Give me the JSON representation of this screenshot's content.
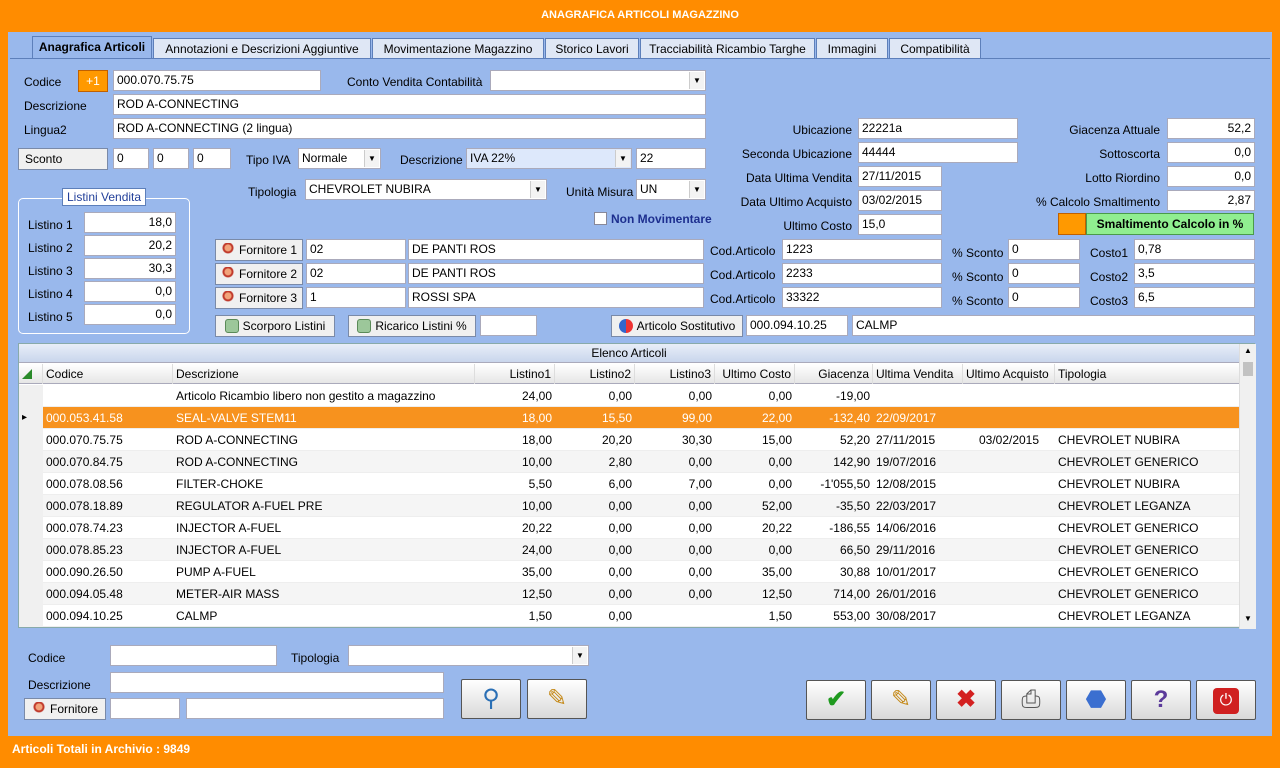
{
  "window": {
    "title": "ANAGRAFICA ARTICOLI MAGAZZINO"
  },
  "tabs": [
    {
      "label": "Anagrafica Articoli",
      "active": true
    },
    {
      "label": "Annotazioni  e Descrizioni Aggiuntive"
    },
    {
      "label": "Movimentazione Magazzino"
    },
    {
      "label": "Storico Lavori"
    },
    {
      "label": "Tracciabilità Ricambio Targhe"
    },
    {
      "label": "Immagini"
    },
    {
      "label": "Compatibilità"
    }
  ],
  "form": {
    "codice_label": "Codice",
    "plus_label": "+1",
    "codice_value": "000.070.75.75",
    "conto_label": "Conto Vendita Contabilità",
    "conto_value": "",
    "descrizione_label": "Descrizione",
    "descrizione_value": "ROD A-CONNECTING",
    "lingua2_label": "Lingua2",
    "lingua2_value": "ROD A-CONNECTING (2 lingua)",
    "sconto_label": "Sconto",
    "sconto1": "0",
    "sconto2": "0",
    "sconto3": "0",
    "tipo_iva_label": "Tipo IVA",
    "tipo_iva_value": "Normale",
    "iva_descr_label": "Descrizione",
    "iva_descr_value": "IVA 22%",
    "iva_code": "22",
    "tipologia_label": "Tipologia",
    "tipologia_value": "CHEVROLET NUBIRA",
    "unita_label": "Unità Misura",
    "unita_value": "UN",
    "non_mov_label": "Non Movimentare",
    "listini_title": "Listini Vendita",
    "listini": [
      {
        "label": "Listino 1",
        "value": "18,0"
      },
      {
        "label": "Listino 2",
        "value": "20,2"
      },
      {
        "label": "Listino 3",
        "value": "30,3"
      },
      {
        "label": "Listino 4",
        "value": "0,0"
      },
      {
        "label": "Listino 5",
        "value": "0,0"
      }
    ],
    "ubicazione_label": "Ubicazione",
    "ubicazione_value": "22221a",
    "seconda_ubic_label": "Seconda Ubicazione",
    "seconda_ubic_value": "44444",
    "data_vendita_label": "Data Ultima Vendita",
    "data_vendita_value": "27/11/2015",
    "data_acquisto_label": "Data Ultimo Acquisto",
    "data_acquisto_value": "03/02/2015",
    "ultimo_costo_label": "Ultimo Costo",
    "ultimo_costo_value": "15,0",
    "giacenza_label": "Giacenza Attuale",
    "giacenza_value": "52,2",
    "sottoscorta_label": "Sottoscorta",
    "sottoscorta_value": "0,0",
    "lotto_label": "Lotto Riordino",
    "lotto_value": "0,0",
    "calcolo_label": "% Calcolo Smaltimento",
    "calcolo_value": "2,87",
    "smalt_label": "Smaltimento Calcolo in %",
    "fornitori": [
      {
        "button": "Fornitore 1",
        "code": "02",
        "name": "DE PANTI ROS",
        "cod_label": "Cod.Articolo",
        "cod_value": "1223",
        "sconto_label": "% Sconto",
        "sconto_value": "0",
        "costo_label": "Costo1",
        "costo_value": "0,78"
      },
      {
        "button": "Fornitore 2",
        "code": "02",
        "name": "DE PANTI ROS",
        "cod_label": "Cod.Articolo",
        "cod_value": "2233",
        "sconto_label": "% Sconto",
        "sconto_value": "0",
        "costo_label": "Costo2",
        "costo_value": "3,5"
      },
      {
        "button": "Fornitore 3",
        "code": "1",
        "name": "ROSSI SPA",
        "cod_label": "Cod.Articolo",
        "cod_value": "33322",
        "sconto_label": "% Sconto",
        "sconto_value": "0",
        "costo_label": "Costo3",
        "costo_value": "6,5"
      }
    ],
    "scorporo_label": "Scorporo Listini",
    "ricarico_label": "Ricarico Listini %",
    "ricarico_value": "",
    "sostitutivo_label": "Articolo Sostitutivo",
    "sostitutivo_code": "000.094.10.25",
    "sostitutivo_name": "CALMP"
  },
  "grid": {
    "title": "Elenco Articoli",
    "columns": [
      "Codice",
      "Descrizione",
      "Listino1",
      "Listino2",
      "Listino3",
      "Ultimo Costo",
      "Giacenza",
      "Ultima Vendita",
      "Ultimo Acquisto",
      "Tipologia"
    ],
    "rows": [
      [
        "",
        "Articolo Ricambio libero non gestito a magazzino",
        "24,00",
        "0,00",
        "0,00",
        "0,00",
        "-19,00",
        "",
        "",
        ""
      ],
      [
        "000.053.41.58",
        "SEAL-VALVE STEM11",
        "18,00",
        "15,50",
        "99,00",
        "22,00",
        "-132,40",
        "22/09/2017",
        "",
        ""
      ],
      [
        "000.070.75.75",
        "ROD A-CONNECTING",
        "18,00",
        "20,20",
        "30,30",
        "15,00",
        "52,20",
        "27/11/2015",
        "03/02/2015",
        "CHEVROLET NUBIRA"
      ],
      [
        "000.070.84.75",
        "ROD A-CONNECTING",
        "10,00",
        "2,80",
        "0,00",
        "0,00",
        "142,90",
        "19/07/2016",
        "",
        "CHEVROLET GENERICO"
      ],
      [
        "000.078.08.56",
        "FILTER-CHOKE",
        "5,50",
        "6,00",
        "7,00",
        "0,00",
        "-1'055,50",
        "12/08/2015",
        "",
        "CHEVROLET NUBIRA"
      ],
      [
        "000.078.18.89",
        "REGULATOR A-FUEL PRE",
        "10,00",
        "0,00",
        "0,00",
        "52,00",
        "-35,50",
        "22/03/2017",
        "",
        "CHEVROLET LEGANZA"
      ],
      [
        "000.078.74.23",
        "INJECTOR A-FUEL",
        "20,22",
        "0,00",
        "0,00",
        "20,22",
        "-186,55",
        "14/06/2016",
        "",
        "CHEVROLET GENERICO"
      ],
      [
        "000.078.85.23",
        "INJECTOR A-FUEL",
        "24,00",
        "0,00",
        "0,00",
        "0,00",
        "66,50",
        "29/11/2016",
        "",
        "CHEVROLET GENERICO"
      ],
      [
        "000.090.26.50",
        "PUMP A-FUEL",
        "35,00",
        "0,00",
        "0,00",
        "35,00",
        "30,88",
        "10/01/2017",
        "",
        "CHEVROLET GENERICO"
      ],
      [
        "000.094.05.48",
        "METER-AIR MASS",
        "12,50",
        "0,00",
        "0,00",
        "12,50",
        "714,00",
        "26/01/2016",
        "",
        "CHEVROLET GENERICO"
      ],
      [
        "000.094.10.25",
        "CALMP",
        "1,50",
        "0,00",
        "",
        "1,50",
        "553,00",
        "30/08/2017",
        "",
        "CHEVROLET LEGANZA"
      ]
    ]
  },
  "filter": {
    "codice_label": "Codice",
    "codice_value": "",
    "tipologia_label": "Tipologia",
    "tipologia_value": "",
    "descrizione_label": "Descrizione",
    "descrizione_value": "",
    "fornitore_label": "Fornitore",
    "fornitore_code": "",
    "fornitore_name": ""
  },
  "status": {
    "text": "Articoli Totali in Archivio : 9849"
  }
}
